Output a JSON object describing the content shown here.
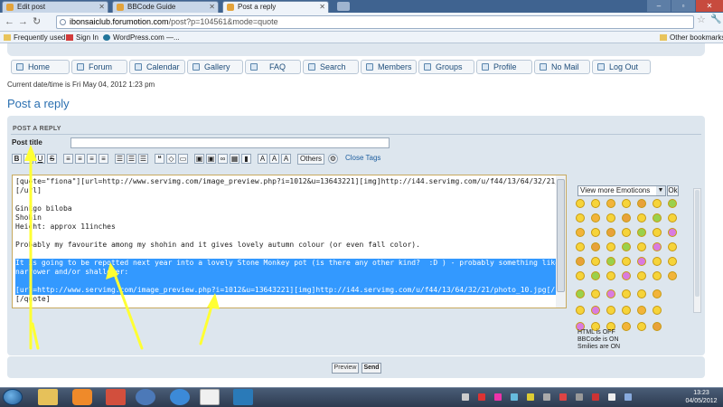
{
  "browser": {
    "tabs": [
      {
        "label": "Edit post"
      },
      {
        "label": "BBCode Guide"
      },
      {
        "label": "Post a reply"
      }
    ],
    "url_domain": "ibonsaiclub.forumotion.com",
    "url_path": "/post?p=104561&mode=quote",
    "bookmarks": [
      {
        "label": "Frequently used"
      },
      {
        "label": "Sign In"
      },
      {
        "label": "WordPress.com —..."
      }
    ],
    "other_bookmarks": "Other bookmarks"
  },
  "forum_nav": [
    {
      "label": "Home"
    },
    {
      "label": "Forum"
    },
    {
      "label": "Calendar"
    },
    {
      "label": "Gallery"
    },
    {
      "label": "FAQ"
    },
    {
      "label": "Search"
    },
    {
      "label": "Members"
    },
    {
      "label": "Groups"
    },
    {
      "label": "Profile"
    },
    {
      "label": "No Mail"
    },
    {
      "label": "Log Out"
    }
  ],
  "current_datetime": "Current date/time is Fri May 04, 2012 1:23 pm",
  "page_title": "Post a reply",
  "form": {
    "section_header": "POST A REPLY",
    "post_title_label": "Post title",
    "post_title_value": "",
    "toolbar": {
      "bold": "B",
      "italic": "I",
      "underline": "U",
      "strike": "S",
      "others": "Others",
      "close_tags": "Close Tags"
    },
    "message_lines": [
      "[quote=\"fiona\"][url=http://www.servimg.com/image_preview.php?i=1012&u=13643221][img]http://i44.servimg.com/u/f44/13/64/32/21/ginkgo11.jpg[/img]",
      "[/url]",
      "",
      "Ginkgo biloba",
      "Shohin",
      "Height: approx 11inches",
      "",
      "Probably my favourite among my shohin and it gives lovely autumn colour (or even fall color).",
      "",
      "It is going to be repotted next year into a lovely Stone Monkey pot (is there any other kind?  :D ) - probably something like this although maybe a bit",
      "narrower and/or shallower:",
      "",
      "[url=http://www.servimg.com/image_preview.php?i=1012&u=13643221][img]http://i44.servimg.com/u/f44/13/64/32/21/photo_10.jpg[/img][/url]",
      "[/quote]"
    ],
    "emoticons_select": "View more Emoticons",
    "emoticons_ok": "Ok",
    "html_status": "HTML is OFF",
    "bbcode_status": "BBCode is ON",
    "smilies_status": "Smilies are ON",
    "preview_button": "Preview",
    "send_button": "Send"
  },
  "taskbar": {
    "time": "13:23",
    "date": "04/05/2012"
  },
  "colors": {
    "selection": "#3399ff",
    "annotation_arrow": "#ffff33",
    "link_blue": "#2a6fb0"
  }
}
